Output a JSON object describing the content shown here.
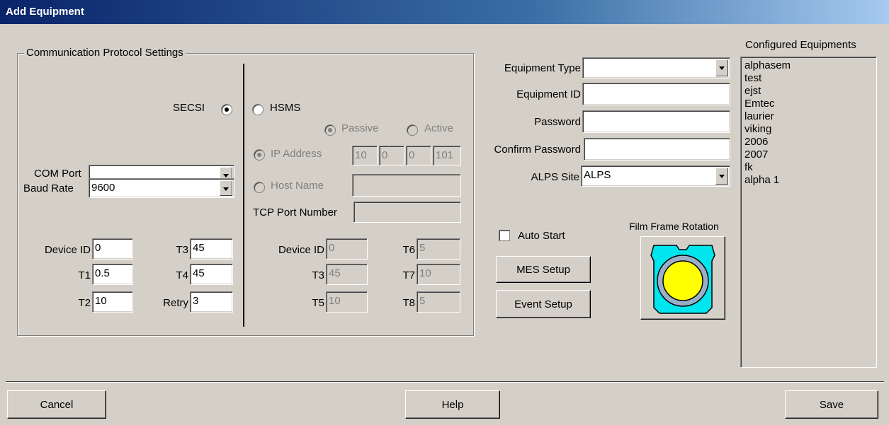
{
  "window": {
    "title": "Add Equipment"
  },
  "comm": {
    "group_title": "Communication Protocol Settings",
    "secsi_label": "SECSI",
    "hsms_label": "HSMS",
    "passive_label": "Passive",
    "active_label": "Active",
    "com_port_label": "COM Port",
    "com_port_value": "",
    "baud_rate_label": "Baud Rate",
    "baud_rate_value": "9600",
    "ip_address_label": "IP Address",
    "ip_octets": [
      "10",
      "0",
      "0",
      "101"
    ],
    "host_name_label": "Host Name",
    "host_name_value": "",
    "tcp_port_label": "TCP Port Number",
    "tcp_port_value": "",
    "secs": {
      "device_id_label": "Device ID",
      "device_id": "0",
      "t1_label": "T1",
      "t1": "0.5",
      "t2_label": "T2",
      "t2": "10",
      "t3_label": "T3",
      "t3": "45",
      "t4_label": "T4",
      "t4": "45",
      "retry_label": "Retry",
      "retry": "3"
    },
    "hsms_params": {
      "device_id_label": "Device ID",
      "device_id": "0",
      "t3_label": "T3",
      "t3": "45",
      "t5_label": "T5",
      "t5": "10",
      "t6_label": "T6",
      "t6": "5",
      "t7_label": "T7",
      "t7": "10",
      "t8_label": "T8",
      "t8": "5"
    }
  },
  "equipment": {
    "type_label": "Equipment Type",
    "type_value": "",
    "id_label": "Equipment ID",
    "id_value": "",
    "password_label": "Password",
    "password_value": "",
    "confirm_label": "Confirm Password",
    "confirm_value": "",
    "site_label": "ALPS Site",
    "site_value": "ALPS"
  },
  "auto_start_label": "Auto Start",
  "mes_setup_label": "MES Setup",
  "event_setup_label": "Event Setup",
  "film_frame_label": "Film Frame Rotation",
  "configured": {
    "title": "Configured Equipments",
    "items": [
      "alphasem",
      "test",
      "ejst",
      "Emtec",
      "laurier",
      "viking",
      "2006",
      "2007",
      "fk",
      "alpha 1"
    ]
  },
  "footer": {
    "cancel": "Cancel",
    "help": "Help",
    "save": "Save"
  },
  "colors": {
    "title_start": "#0a246a",
    "frame_cyan": "#00e5ee",
    "frame_yellow": "#ffff00"
  }
}
